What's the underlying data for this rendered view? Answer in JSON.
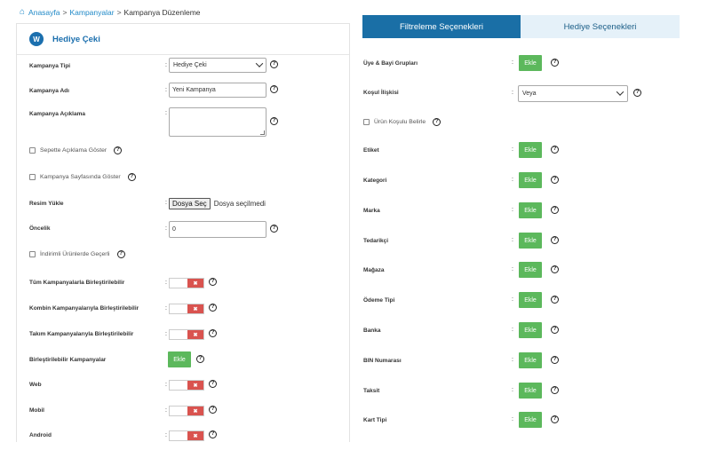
{
  "breadcrumb": {
    "home": "Anasayfa",
    "campaigns": "Kampanyalar",
    "current": "Kampanya Düzenleme",
    "separator": ">"
  },
  "card": {
    "icon_letter": "W",
    "title": "Hediye Çeki"
  },
  "form": {
    "campaign_type": {
      "label": "Kampanya Tipi",
      "value": "Hediye Çeki"
    },
    "campaign_name": {
      "label": "Kampanya Adı",
      "value": "Yeni Kampanya"
    },
    "campaign_desc": {
      "label": "Kampanya Açıklama",
      "value": ""
    },
    "show_desc_in_cart": {
      "label": "Sepette Açıklama Göster",
      "checked": false
    },
    "show_on_campaign_page": {
      "label": "Kampanya Sayfasında Göster",
      "checked": false
    },
    "image_upload": {
      "label": "Resim Yükle",
      "button": "Dosya Seç",
      "status": "Dosya seçilmedi"
    },
    "priority": {
      "label": "Öncelik",
      "value": "0"
    },
    "discounted_products": {
      "label": "İndirimli Ürünlerde Geçerli",
      "checked": false
    },
    "merge_all": {
      "label": "Tüm Kampanyalarla Birleştirilebilir",
      "state": "off"
    },
    "merge_combo": {
      "label": "Kombin Kampanyalarıyla Birleştirilebilir",
      "state": "off"
    },
    "merge_team": {
      "label": "Takım Kampanyalarıyla Birleştirilebilir",
      "state": "off"
    },
    "mergeable": {
      "label": "Birleştirilebilir Kampanyalar",
      "button": "Ekle"
    },
    "web": {
      "label": "Web",
      "state": "off"
    },
    "mobile": {
      "label": "Mobil",
      "state": "off"
    },
    "android": {
      "label": "Android",
      "state": "off"
    }
  },
  "common": {
    "colon": ":",
    "help": "?",
    "toggle_off": "✖"
  },
  "tabs": [
    {
      "label": "Filtreleme Seçenekleri",
      "active": true
    },
    {
      "label": "Hediye Seçenekleri",
      "active": false
    }
  ],
  "filters": {
    "member_groups": {
      "label": "Üye & Bayi Grupları",
      "button": "Ekle"
    },
    "condition_relation": {
      "label": "Koşul İlişkisi",
      "value": "Veya"
    },
    "product_condition": {
      "label": "Ürün Koşulu Belirle",
      "checked": false
    },
    "tag": {
      "label": "Etiket",
      "button": "Ekle"
    },
    "category": {
      "label": "Kategori",
      "button": "Ekle"
    },
    "brand": {
      "label": "Marka",
      "button": "Ekle"
    },
    "supplier": {
      "label": "Tedarikçi",
      "button": "Ekle"
    },
    "store": {
      "label": "Mağaza",
      "button": "Ekle"
    },
    "payment_type": {
      "label": "Ödeme Tipi",
      "button": "Ekle"
    },
    "bank": {
      "label": "Banka",
      "button": "Ekle"
    },
    "bin": {
      "label": "BIN Numarası",
      "button": "Ekle"
    },
    "installment": {
      "label": "Taksit",
      "button": "Ekle"
    },
    "card_type": {
      "label": "Kart Tipi",
      "button": "Ekle"
    }
  },
  "colors": {
    "primary": "#1a6fa6",
    "success": "#5cb85c",
    "danger": "#d9534f",
    "link": "#1e88c7"
  }
}
